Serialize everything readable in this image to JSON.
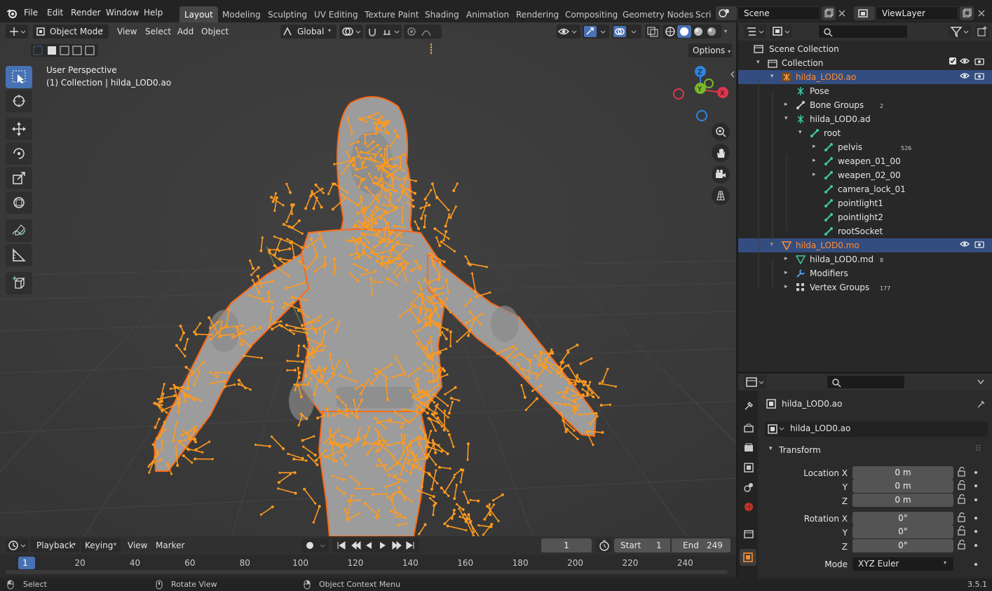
{
  "topbar": {
    "menu": [
      "File",
      "Edit",
      "Render",
      "Window",
      "Help"
    ],
    "workspaces": [
      "Layout",
      "Modeling",
      "Sculpting",
      "UV Editing",
      "Texture Paint",
      "Shading",
      "Animation",
      "Rendering",
      "Compositing",
      "Geometry Nodes",
      "Scri"
    ],
    "active_workspace": "Layout",
    "scene": "Scene",
    "view_layer": "ViewLayer"
  },
  "viewport_header": {
    "mode": "Object Mode",
    "menus": [
      "View",
      "Select",
      "Add",
      "Object"
    ],
    "orientation": "Global",
    "options": "Options"
  },
  "viewport": {
    "perspective": "User Perspective",
    "collection_info": "(1) Collection | hilda_LOD0.ao",
    "gizmo": {
      "z": "Z",
      "y": "Y",
      "x": "X"
    },
    "bone_color": "#ff9a1f",
    "outline_color": "#ff6a14"
  },
  "outliner": {
    "scene_collection": "Scene Collection",
    "rows": [
      {
        "label": "Collection",
        "level": 1,
        "arrow": "▾",
        "icon": "collection-icon"
      },
      {
        "label": "hilda_LOD0.ao",
        "level": 2,
        "arrow": "▾",
        "icon": "armature-icon",
        "selected": true,
        "orange": true
      },
      {
        "label": "Pose",
        "level": 3,
        "arrow": "",
        "icon": "pose-icon"
      },
      {
        "label": "Bone Groups",
        "level": 3,
        "arrow": "▸",
        "icon": "bone-groups-icon",
        "badge": "2"
      },
      {
        "label": "hilda_LOD0.ad",
        "level": 3,
        "arrow": "▾",
        "icon": "armature-data-icon"
      },
      {
        "label": "root",
        "level": 4,
        "arrow": "▾",
        "icon": "bone-icon"
      },
      {
        "label": "pelvis",
        "level": 5,
        "arrow": "▸",
        "icon": "bone-icon",
        "badge": "526"
      },
      {
        "label": "weapen_01_00",
        "level": 5,
        "arrow": "▸",
        "icon": "bone-icon"
      },
      {
        "label": "weapen_02_00",
        "level": 5,
        "arrow": "▸",
        "icon": "bone-icon"
      },
      {
        "label": "camera_lock_01",
        "level": 5,
        "arrow": "",
        "icon": "bone-icon"
      },
      {
        "label": "pointlight1",
        "level": 5,
        "arrow": "",
        "icon": "bone-icon"
      },
      {
        "label": "pointlight2",
        "level": 5,
        "arrow": "",
        "icon": "bone-icon"
      },
      {
        "label": "rootSocket",
        "level": 5,
        "arrow": "",
        "icon": "bone-icon"
      },
      {
        "label": "hilda_LOD0.mo",
        "level": 2,
        "arrow": "▾",
        "icon": "mesh-icon",
        "selected": true,
        "orange": true
      },
      {
        "label": "hilda_LOD0.md",
        "level": 3,
        "arrow": "▸",
        "icon": "mesh-data-icon",
        "badge": "8"
      },
      {
        "label": "Modifiers",
        "level": 3,
        "arrow": "▸",
        "icon": "wrench-icon"
      },
      {
        "label": "Vertex Groups",
        "level": 3,
        "arrow": "▸",
        "icon": "vertex-groups-icon",
        "badge": "177"
      }
    ]
  },
  "properties": {
    "object_name": "hilda_LOD0.ao",
    "data_name": "hilda_LOD0.ao",
    "panel_title": "Transform",
    "location_label": "Location X",
    "location": [
      "0 m",
      "0 m",
      "0 m"
    ],
    "rotation_label": "Rotation X",
    "rotation": [
      "0°",
      "0°",
      "0°"
    ],
    "axis_y": "Y",
    "axis_z": "Z",
    "mode_label": "Mode",
    "mode_value": "XYZ Euler"
  },
  "timeline": {
    "menus": [
      "Playback",
      "Keying",
      "View",
      "Marker"
    ],
    "current_frame": "1",
    "start_label": "Start",
    "start": "1",
    "end_label": "End",
    "end": "249",
    "ticks": [
      "1",
      "20",
      "40",
      "60",
      "80",
      "100",
      "120",
      "140",
      "160",
      "180",
      "200",
      "220",
      "240"
    ]
  },
  "statusbar": {
    "select": "Select",
    "rotate": "Rotate View",
    "context": "Object Context Menu",
    "version": "3.5.1"
  }
}
